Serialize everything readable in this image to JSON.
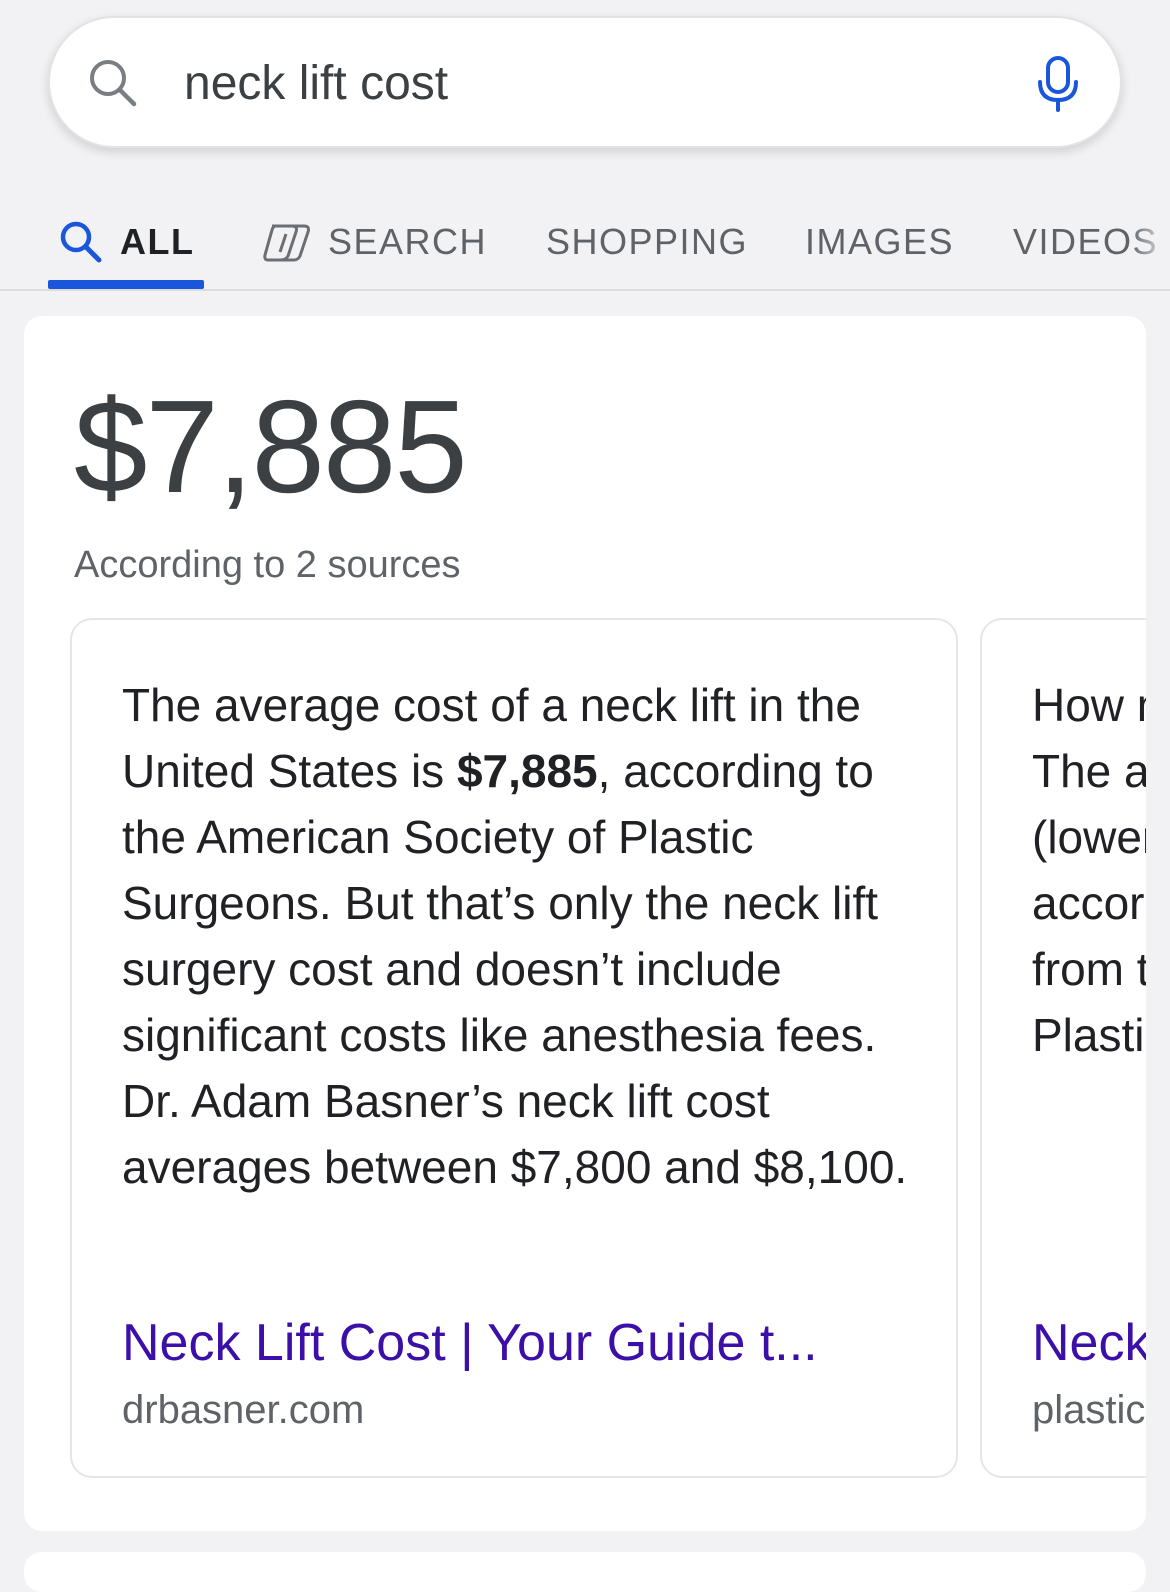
{
  "search": {
    "query": "neck lift cost",
    "search_icon": "search-icon",
    "mic_icon": "microphone-icon"
  },
  "tabs": [
    {
      "label": "ALL",
      "icon": "search-icon",
      "active": true
    },
    {
      "label": "SEARCH",
      "icon": "copilot-icon",
      "active": false
    },
    {
      "label": "SHOPPING",
      "active": false
    },
    {
      "label": "IMAGES",
      "active": false
    },
    {
      "label": "VIDEOS",
      "active": false
    }
  ],
  "answer": {
    "value": "$7,885",
    "sources_count": "According to 2 sources"
  },
  "source_cards": [
    {
      "snippet_parts": [
        "The average cost of a neck lift in the United States is ",
        "$7,885",
        ", according to the American Society of Plastic Surgeons. But that’s only the neck lift surgery cost and doesn’t include significant costs like anesthesia fees. Dr. Adam Basner’s neck lift cost averages between $7,800 and $8,100."
      ],
      "title": "Neck Lift Cost | Your Guide t...",
      "domain": "drbasner.com"
    },
    {
      "snippet_lines": [
        "How m",
        "The av",
        "(lower",
        "accord",
        "from th",
        "Plastic"
      ],
      "title": "Neck",
      "domain": "plastics"
    }
  ],
  "colors": {
    "accent": "#1a56db",
    "link_visited": "#3c0fa8",
    "background": "#f2f2f4"
  }
}
